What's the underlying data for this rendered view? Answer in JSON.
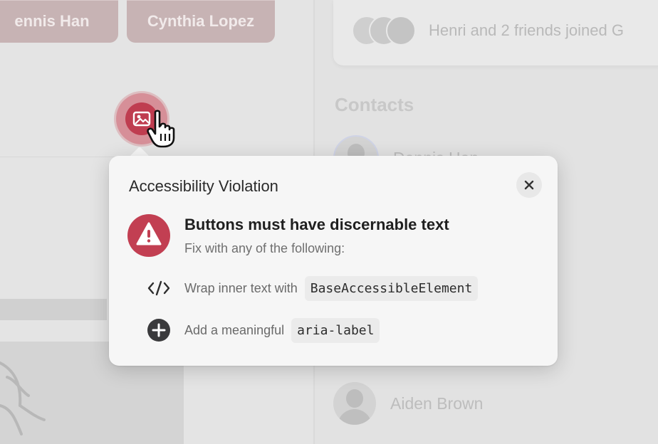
{
  "background": {
    "people_chips": [
      "ennis Han",
      "Cynthia Lopez"
    ],
    "activity": {
      "text": "Henri and 2 friends joined G"
    },
    "contacts": {
      "title": "Contacts",
      "items": [
        {
          "name": "Dennis Han"
        },
        {
          "name": "Aiden Brown"
        }
      ]
    }
  },
  "flagged_element": {
    "icon": "photo-icon",
    "state": "accessibility-violation"
  },
  "popover": {
    "title": "Accessibility Violation",
    "close_icon": "close-icon",
    "issue": {
      "icon": "warning-icon",
      "title": "Buttons must have discernable text",
      "subtitle": "Fix with any of the following:"
    },
    "fixes": [
      {
        "icon": "code-icon",
        "text": "Wrap inner text with",
        "code": "BaseAccessibleElement"
      },
      {
        "icon": "plus-circle-icon",
        "text": "Add a meaningful",
        "code": "aria-label"
      }
    ]
  },
  "colors": {
    "accent_red": "#c23f52",
    "popover_bg": "#f6f6f6",
    "chip_bg": "#c7b3b4"
  }
}
